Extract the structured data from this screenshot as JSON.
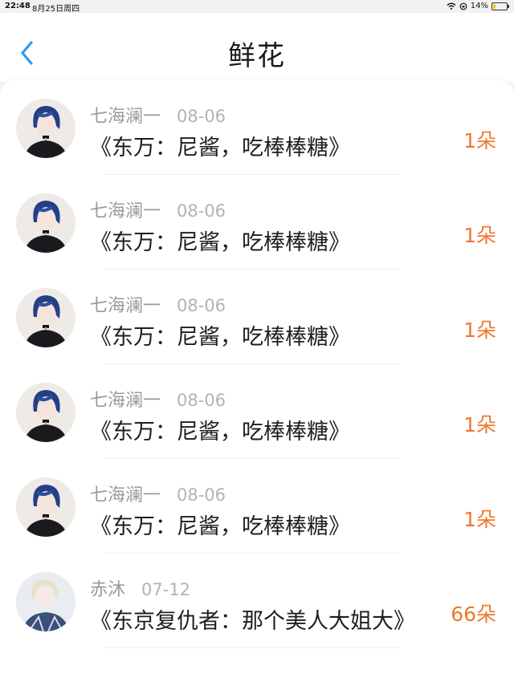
{
  "status_bar": {
    "time": "22:48",
    "date": "8月25日周四",
    "battery": "14%",
    "battery_level": 0.14,
    "icons": [
      "wifi-icon",
      "orientation-lock-icon",
      "battery-charging-icon"
    ]
  },
  "nav": {
    "title": "鲜花",
    "back_icon": "chevron-left-icon",
    "accent": "#2f9cf0"
  },
  "list": {
    "count_color": "#f0782d",
    "items": [
      {
        "user": "七海澜一",
        "date": "08-06",
        "book": "《东万：尼酱，吃棒棒糖》",
        "count": "1朵",
        "avatar": "blue-hair-avatar"
      },
      {
        "user": "七海澜一",
        "date": "08-06",
        "book": "《东万：尼酱，吃棒棒糖》",
        "count": "1朵",
        "avatar": "blue-hair-avatar"
      },
      {
        "user": "七海澜一",
        "date": "08-06",
        "book": "《东万：尼酱，吃棒棒糖》",
        "count": "1朵",
        "avatar": "blue-hair-avatar"
      },
      {
        "user": "七海澜一",
        "date": "08-06",
        "book": "《东万：尼酱，吃棒棒糖》",
        "count": "1朵",
        "avatar": "blue-hair-avatar"
      },
      {
        "user": "七海澜一",
        "date": "08-06",
        "book": "《东万：尼酱，吃棒棒糖》",
        "count": "1朵",
        "avatar": "blue-hair-avatar"
      },
      {
        "user": "赤沐",
        "date": "07-12",
        "book": "《东京复仇者：那个美人大姐大》",
        "count": "66朵",
        "avatar": "silver-hair-avatar"
      }
    ]
  }
}
